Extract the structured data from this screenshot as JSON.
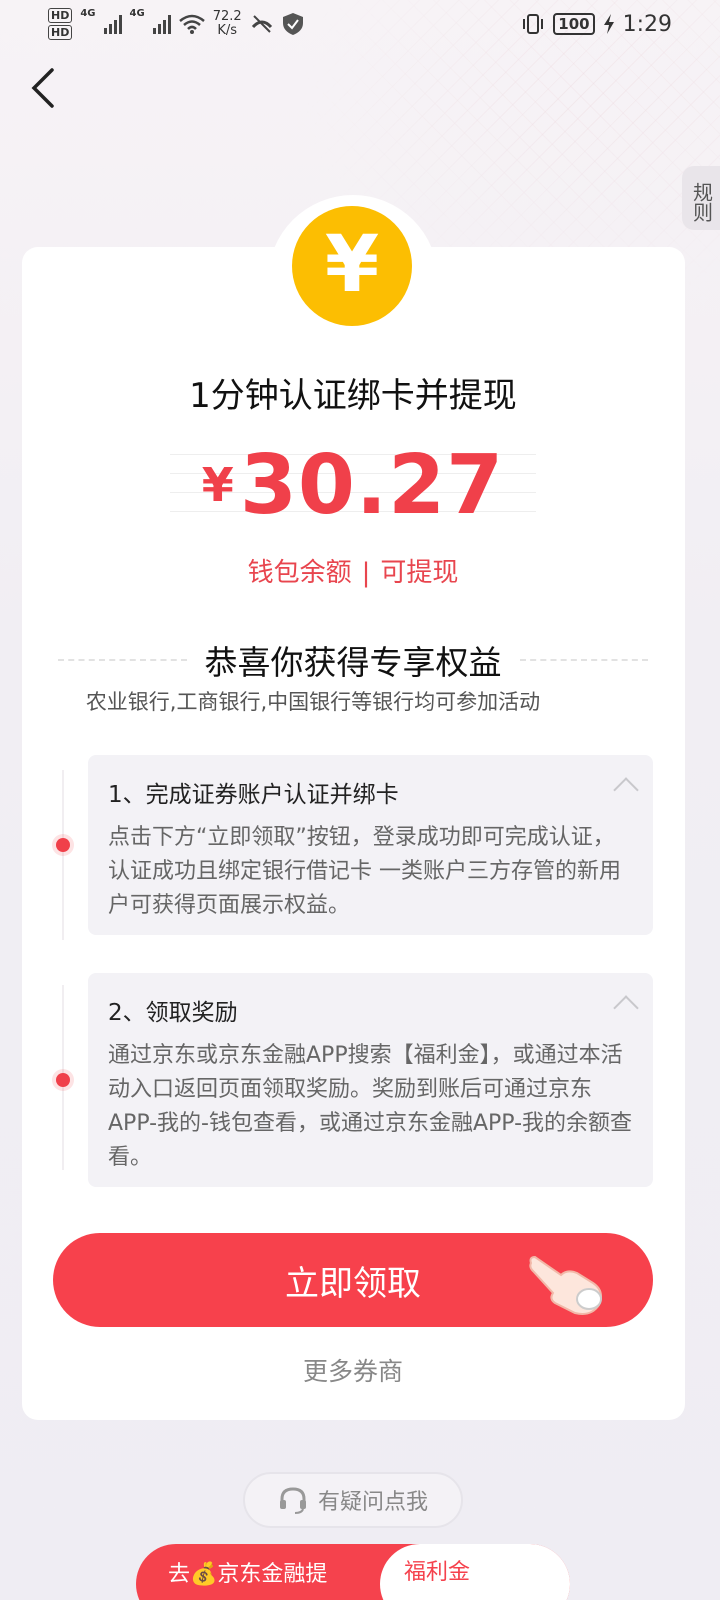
{
  "status_bar": {
    "speed": "72.2",
    "speed_unit": "K/s",
    "battery": "100",
    "time": "1:29",
    "net_left": "4G",
    "net_right": "4G"
  },
  "header": {
    "back_icon": "chevron-left-icon",
    "rules_label": "规则"
  },
  "card": {
    "coin_symbol": "¥",
    "headline": "1分钟认证绑卡并提现",
    "amount_currency": "¥",
    "amount_value": "30.27",
    "wallet_label": "钱包余额",
    "wallet_sep": "|",
    "wallet_action": "可提现",
    "congrats_title": "恭喜你获得专享权益",
    "banks_note": "农业银行,工商银行,中国银行等银行均可参加活动",
    "steps": [
      {
        "title": "1、完成证券账户认证并绑卡",
        "desc": "点击下方“立即领取”按钮，登录成功即可完成认证，认证成功且绑定银行借记卡 一类账户三方存管的新用户可获得页面展示权益。"
      },
      {
        "title": "2、领取奖励",
        "desc": "通过京东或京东金融APP搜索【福利金】，或通过本活动入口返回页面领取奖励。奖励到账后可通过京东APP-我的-钱包查看，或通过京东金融APP-我的余额查看。"
      }
    ],
    "claim_button": "立即领取",
    "more_brokers": "更多券商"
  },
  "help": {
    "label": "有疑问点我",
    "icon": "headset-icon"
  },
  "bottom": {
    "left_text": "去💰京东金融提",
    "right_text": "福利金"
  },
  "colors": {
    "accent": "#f7414c",
    "coin": "#fcbe02"
  }
}
